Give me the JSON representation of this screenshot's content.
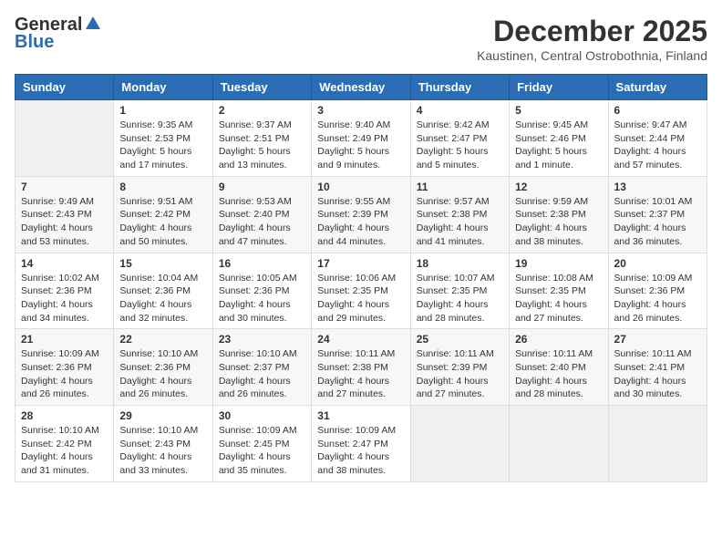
{
  "header": {
    "logo_general": "General",
    "logo_blue": "Blue",
    "title": "December 2025",
    "location": "Kaustinen, Central Ostrobothnia, Finland"
  },
  "calendar": {
    "days_of_week": [
      "Sunday",
      "Monday",
      "Tuesday",
      "Wednesday",
      "Thursday",
      "Friday",
      "Saturday"
    ],
    "weeks": [
      [
        {
          "day": "",
          "content": ""
        },
        {
          "day": "1",
          "content": "Sunrise: 9:35 AM\nSunset: 2:53 PM\nDaylight: 5 hours\nand 17 minutes."
        },
        {
          "day": "2",
          "content": "Sunrise: 9:37 AM\nSunset: 2:51 PM\nDaylight: 5 hours\nand 13 minutes."
        },
        {
          "day": "3",
          "content": "Sunrise: 9:40 AM\nSunset: 2:49 PM\nDaylight: 5 hours\nand 9 minutes."
        },
        {
          "day": "4",
          "content": "Sunrise: 9:42 AM\nSunset: 2:47 PM\nDaylight: 5 hours\nand 5 minutes."
        },
        {
          "day": "5",
          "content": "Sunrise: 9:45 AM\nSunset: 2:46 PM\nDaylight: 5 hours\nand 1 minute."
        },
        {
          "day": "6",
          "content": "Sunrise: 9:47 AM\nSunset: 2:44 PM\nDaylight: 4 hours\nand 57 minutes."
        }
      ],
      [
        {
          "day": "7",
          "content": "Sunrise: 9:49 AM\nSunset: 2:43 PM\nDaylight: 4 hours\nand 53 minutes."
        },
        {
          "day": "8",
          "content": "Sunrise: 9:51 AM\nSunset: 2:42 PM\nDaylight: 4 hours\nand 50 minutes."
        },
        {
          "day": "9",
          "content": "Sunrise: 9:53 AM\nSunset: 2:40 PM\nDaylight: 4 hours\nand 47 minutes."
        },
        {
          "day": "10",
          "content": "Sunrise: 9:55 AM\nSunset: 2:39 PM\nDaylight: 4 hours\nand 44 minutes."
        },
        {
          "day": "11",
          "content": "Sunrise: 9:57 AM\nSunset: 2:38 PM\nDaylight: 4 hours\nand 41 minutes."
        },
        {
          "day": "12",
          "content": "Sunrise: 9:59 AM\nSunset: 2:38 PM\nDaylight: 4 hours\nand 38 minutes."
        },
        {
          "day": "13",
          "content": "Sunrise: 10:01 AM\nSunset: 2:37 PM\nDaylight: 4 hours\nand 36 minutes."
        }
      ],
      [
        {
          "day": "14",
          "content": "Sunrise: 10:02 AM\nSunset: 2:36 PM\nDaylight: 4 hours\nand 34 minutes."
        },
        {
          "day": "15",
          "content": "Sunrise: 10:04 AM\nSunset: 2:36 PM\nDaylight: 4 hours\nand 32 minutes."
        },
        {
          "day": "16",
          "content": "Sunrise: 10:05 AM\nSunset: 2:36 PM\nDaylight: 4 hours\nand 30 minutes."
        },
        {
          "day": "17",
          "content": "Sunrise: 10:06 AM\nSunset: 2:35 PM\nDaylight: 4 hours\nand 29 minutes."
        },
        {
          "day": "18",
          "content": "Sunrise: 10:07 AM\nSunset: 2:35 PM\nDaylight: 4 hours\nand 28 minutes."
        },
        {
          "day": "19",
          "content": "Sunrise: 10:08 AM\nSunset: 2:35 PM\nDaylight: 4 hours\nand 27 minutes."
        },
        {
          "day": "20",
          "content": "Sunrise: 10:09 AM\nSunset: 2:36 PM\nDaylight: 4 hours\nand 26 minutes."
        }
      ],
      [
        {
          "day": "21",
          "content": "Sunrise: 10:09 AM\nSunset: 2:36 PM\nDaylight: 4 hours\nand 26 minutes."
        },
        {
          "day": "22",
          "content": "Sunrise: 10:10 AM\nSunset: 2:36 PM\nDaylight: 4 hours\nand 26 minutes."
        },
        {
          "day": "23",
          "content": "Sunrise: 10:10 AM\nSunset: 2:37 PM\nDaylight: 4 hours\nand 26 minutes."
        },
        {
          "day": "24",
          "content": "Sunrise: 10:11 AM\nSunset: 2:38 PM\nDaylight: 4 hours\nand 27 minutes."
        },
        {
          "day": "25",
          "content": "Sunrise: 10:11 AM\nSunset: 2:39 PM\nDaylight: 4 hours\nand 27 minutes."
        },
        {
          "day": "26",
          "content": "Sunrise: 10:11 AM\nSunset: 2:40 PM\nDaylight: 4 hours\nand 28 minutes."
        },
        {
          "day": "27",
          "content": "Sunrise: 10:11 AM\nSunset: 2:41 PM\nDaylight: 4 hours\nand 30 minutes."
        }
      ],
      [
        {
          "day": "28",
          "content": "Sunrise: 10:10 AM\nSunset: 2:42 PM\nDaylight: 4 hours\nand 31 minutes."
        },
        {
          "day": "29",
          "content": "Sunrise: 10:10 AM\nSunset: 2:43 PM\nDaylight: 4 hours\nand 33 minutes."
        },
        {
          "day": "30",
          "content": "Sunrise: 10:09 AM\nSunset: 2:45 PM\nDaylight: 4 hours\nand 35 minutes."
        },
        {
          "day": "31",
          "content": "Sunrise: 10:09 AM\nSunset: 2:47 PM\nDaylight: 4 hours\nand 38 minutes."
        },
        {
          "day": "",
          "content": ""
        },
        {
          "day": "",
          "content": ""
        },
        {
          "day": "",
          "content": ""
        }
      ]
    ]
  }
}
